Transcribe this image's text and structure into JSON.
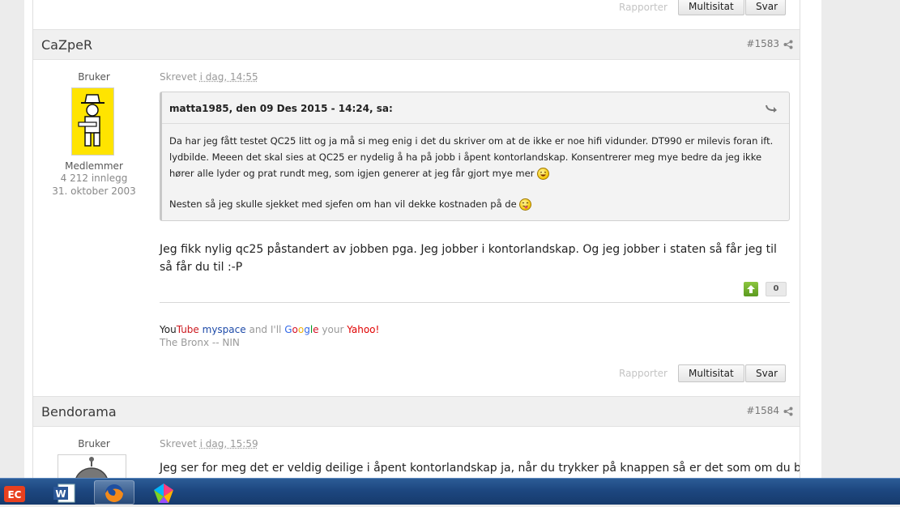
{
  "top_actions": {
    "report_label": "Rapporter",
    "multiquote_label": "Multisitat",
    "reply_label": "Svar"
  },
  "post1": {
    "author": "CaZpeR",
    "post_number": "#1583",
    "role_top": "Bruker",
    "group": "Medlemmer",
    "post_count": "4 212 innlegg",
    "join_date": "31. oktober 2003",
    "posted_prefix": "Skrevet",
    "posted_time": "i dag, 14:55",
    "quote": {
      "header": "matta1985, den 09 Des 2015 - 14:24, sa:",
      "paragraph1": "Da har jeg fått testet QC25 litt og ja må si meg enig i det du skriver om at de ikke er noe hifi vidunder. DT990 er milevis foran ift. lydbilde. Meeen det skal sies at QC25 er nydelig å ha på jobb i åpent kontorlandskap. Konsentrerer meg mye bedre da jeg ikke hører alle lyder og prat rundt meg, som igjen generer at jeg får gjort mye mer",
      "paragraph2": "Nesten så jeg skulle sjekket med sjefen om han vil dekke kostnaden på de"
    },
    "body": "Jeg fikk nylig qc25 påstandert av jobben pga. Jeg jobber i kontorlandskap. Og jeg jobber i staten så får jeg til så får du til :-P",
    "like_count": "0",
    "signature": {
      "you": "You",
      "tube": "Tube",
      "myspace": "myspace",
      "and_ill": "and I'll",
      "g1": "G",
      "o1": "o",
      "o2": "o",
      "g2": "g",
      "l": "l",
      "e": "e",
      "your": "your",
      "yahoo": "Yahoo!",
      "line2": "The Bronx -- NIN"
    },
    "report_label": "Rapporter",
    "multiquote_label": "Multisitat",
    "reply_label": "Svar"
  },
  "post2": {
    "author": "Bendorama",
    "post_number": "#1584",
    "role_top": "Bruker",
    "posted_prefix": "Skrevet",
    "posted_time": "i dag, 15:59",
    "body": "Jeg ser for meg det er veldig deilige i åpent kontorlandskap ja, når du trykker på knappen så er det som om du blir sugd"
  },
  "taskbar": {
    "apps": [
      "ec-app-icon",
      "word-icon",
      "firefox-icon",
      "colorful-app-icon"
    ]
  }
}
